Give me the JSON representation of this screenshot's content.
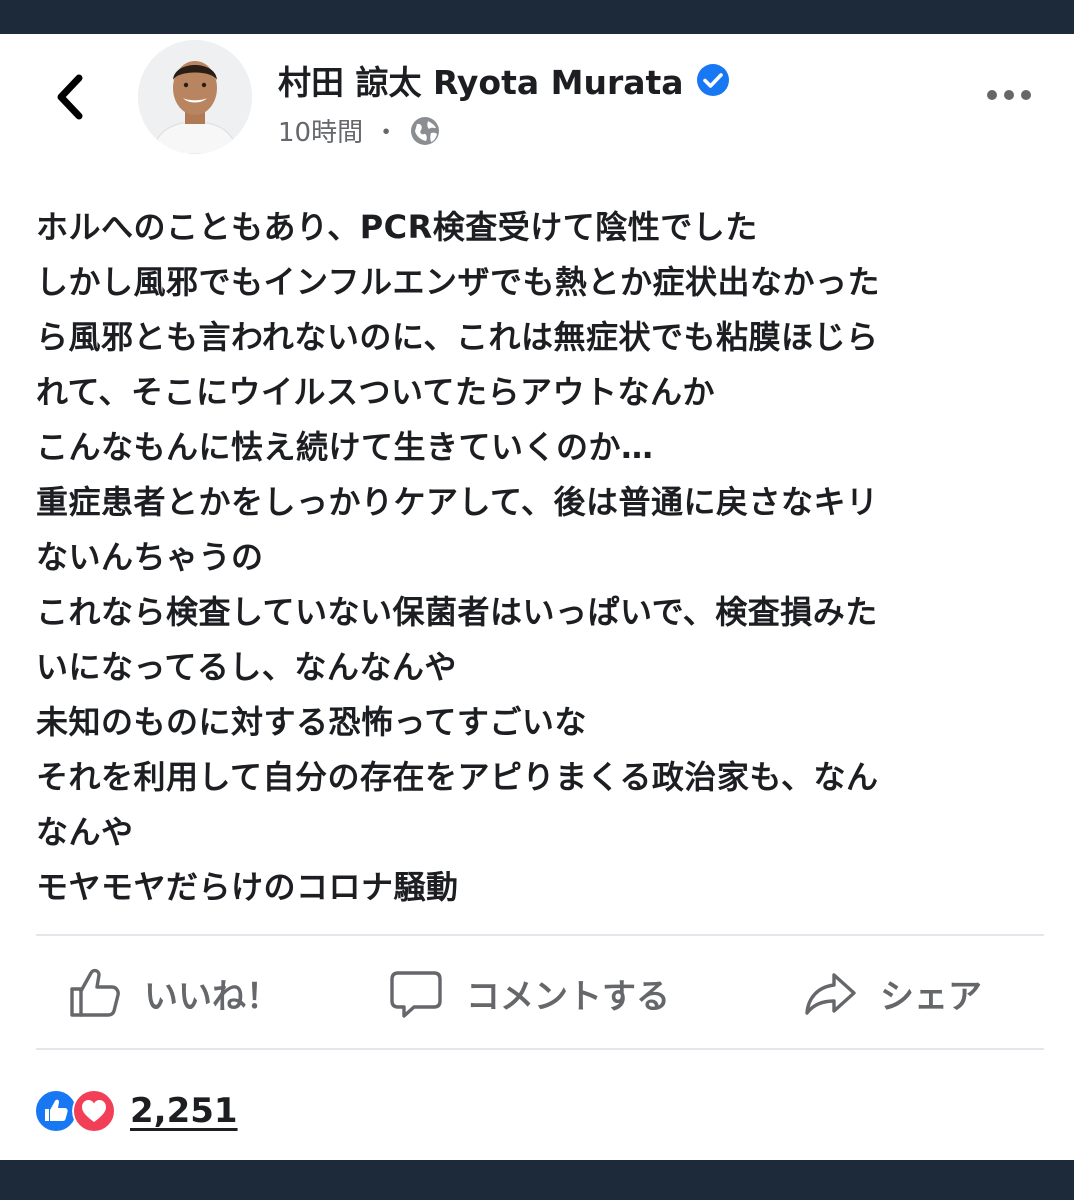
{
  "post": {
    "author": {
      "name": "村田 諒太 Ryota Murata",
      "verified": true,
      "avatar": "avatar-photo"
    },
    "timestamp": "10時間",
    "meta_separator": "・",
    "audience_icon": "globe-icon",
    "back_icon": "chevron-left-icon",
    "more_icon": "more-horizontal-icon",
    "body_lines": [
      "ホルへのこともあり、PCR検査受けて陰性でした",
      "しかし風邪でもインフルエンザでも熱とか症状出なかった",
      "ら風邪とも言われないのに、これは無症状でも粘膜ほじら",
      "れて、そこにウイルスついてたらアウトなんか",
      "こんなもんに怯え続けて生きていくのか…",
      "重症患者とかをしっかりケアして、後は普通に戻さなキリ",
      "ないんちゃうの",
      "これなら検査していない保菌者はいっぱいで、検査損みた",
      "いになってるし、なんなんや",
      "未知のものに対する恐怖ってすごいな",
      "それを利用して自分の存在をアピりまくる政治家も、なん",
      "なんや",
      "モヤモヤだらけのコロナ騒動"
    ]
  },
  "actions": {
    "like_label": "いいね！",
    "comment_label": "コメントする",
    "share_label": "シェア"
  },
  "reactions": {
    "types": [
      "like",
      "love"
    ],
    "count": "2,251"
  },
  "colors": {
    "brand_blue": "#1877f2",
    "love_red": "#f33e58",
    "text_primary": "#1c1e21",
    "text_secondary": "#65676b",
    "frame_dark": "#1d2a3a"
  }
}
